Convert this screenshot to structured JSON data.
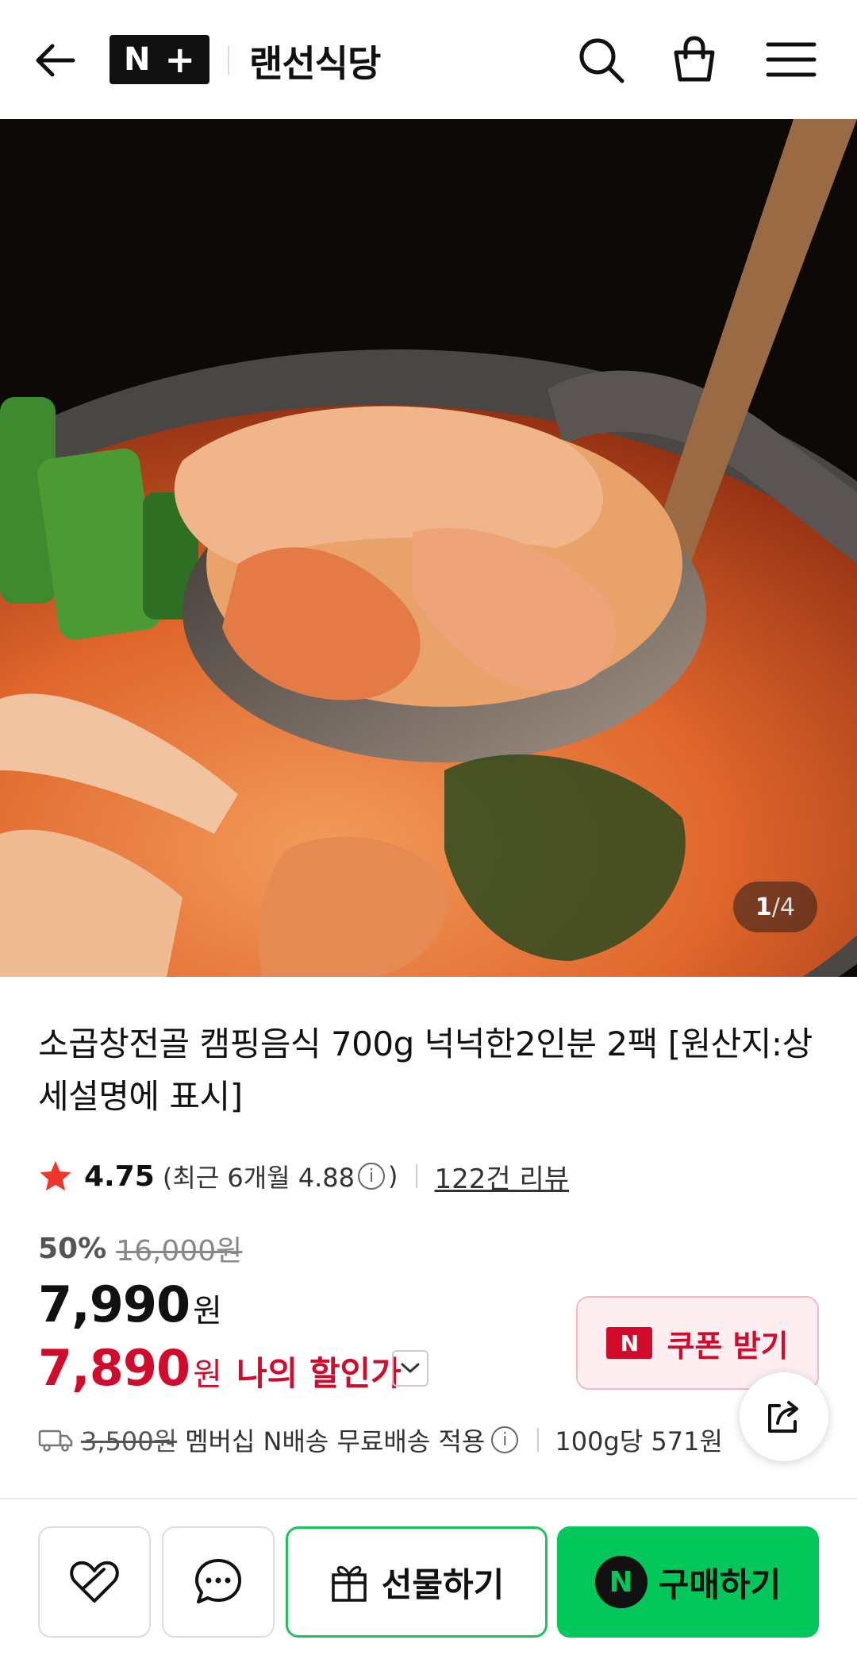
{
  "header": {
    "brand_badge_letter": "N",
    "brand_badge_plus": "+",
    "store_name": "랜선식당"
  },
  "hero": {
    "counter_current": "1",
    "counter_sep": "/",
    "counter_total": "4"
  },
  "product": {
    "title": "소곱창전골 캠핑음식 700g 넉넉한2인분 2팩 [원산지:상세설명에 표시]",
    "rating": "4.75",
    "recent_rating_text": "(최근 6개월 4.88",
    "recent_rating_close": ")",
    "info_icon_glyph": "i",
    "review_link": "122건 리뷰",
    "discount_percent": "50%",
    "original_price": "16,000원",
    "price_amount": "7,990",
    "price_unit": "원",
    "my_price_amount": "7,890",
    "my_price_unit": "원",
    "my_price_label": "나의 할인가",
    "coupon_badge": "N",
    "coupon_label": "쿠폰 받기",
    "shipping_old_fee": "3,500원",
    "shipping_text": "멤버십 N배송 무료배송 적용",
    "unit_price": "100g당 571원"
  },
  "bottom_bar": {
    "gift_label": "선물하기",
    "buy_badge": "N",
    "buy_label": "구매하기"
  },
  "colors": {
    "accent_red": "#d10b2c",
    "naver_green": "#03c75a"
  }
}
